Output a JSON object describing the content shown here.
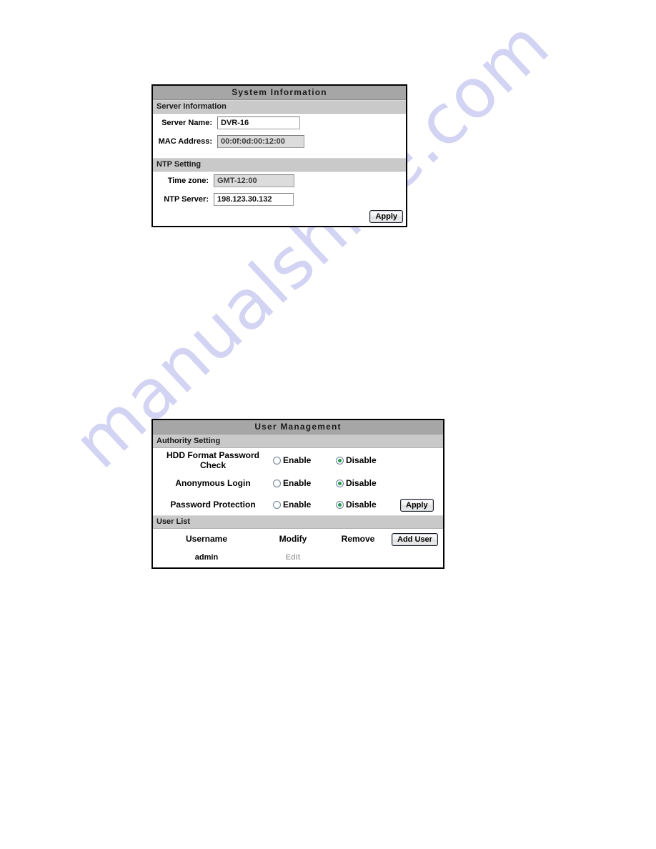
{
  "page": {
    "watermark": "manualshive.com",
    "background_color": "#ffffff",
    "watermark_color": "#ccccf2"
  },
  "system_information": {
    "title": "System Information",
    "sections": [
      {
        "heading": "Server Information",
        "fields": [
          {
            "label": "Server Name:",
            "value": "DVR-16",
            "readonly": false
          },
          {
            "label": "MAC Address:",
            "value": "00:0f:0d:00:12:00",
            "readonly": true
          }
        ]
      },
      {
        "heading": "NTP Setting",
        "fields": [
          {
            "label": "Time zone:",
            "value": "GMT-12:00",
            "readonly": true
          },
          {
            "label": "NTP Server:",
            "value": "198.123.30.132",
            "readonly": false
          }
        ]
      }
    ],
    "apply_label": "Apply"
  },
  "user_management": {
    "title": "User Management",
    "authority_heading": "Authority Setting",
    "enable_label": "Enable",
    "disable_label": "Disable",
    "apply_label": "Apply",
    "authority_rows": [
      {
        "label": "HDD Format Password Check",
        "selected": "Disable"
      },
      {
        "label": "Anonymous  Login",
        "selected": "Disable"
      },
      {
        "label": "Password Protection",
        "selected": "Disable"
      }
    ],
    "user_list_heading": "User List",
    "add_user_label": "Add User",
    "columns": {
      "username": "Username",
      "modify": "Modify",
      "remove": "Remove"
    },
    "users": [
      {
        "username": "admin",
        "modify": "Edit",
        "remove": ""
      }
    ]
  }
}
